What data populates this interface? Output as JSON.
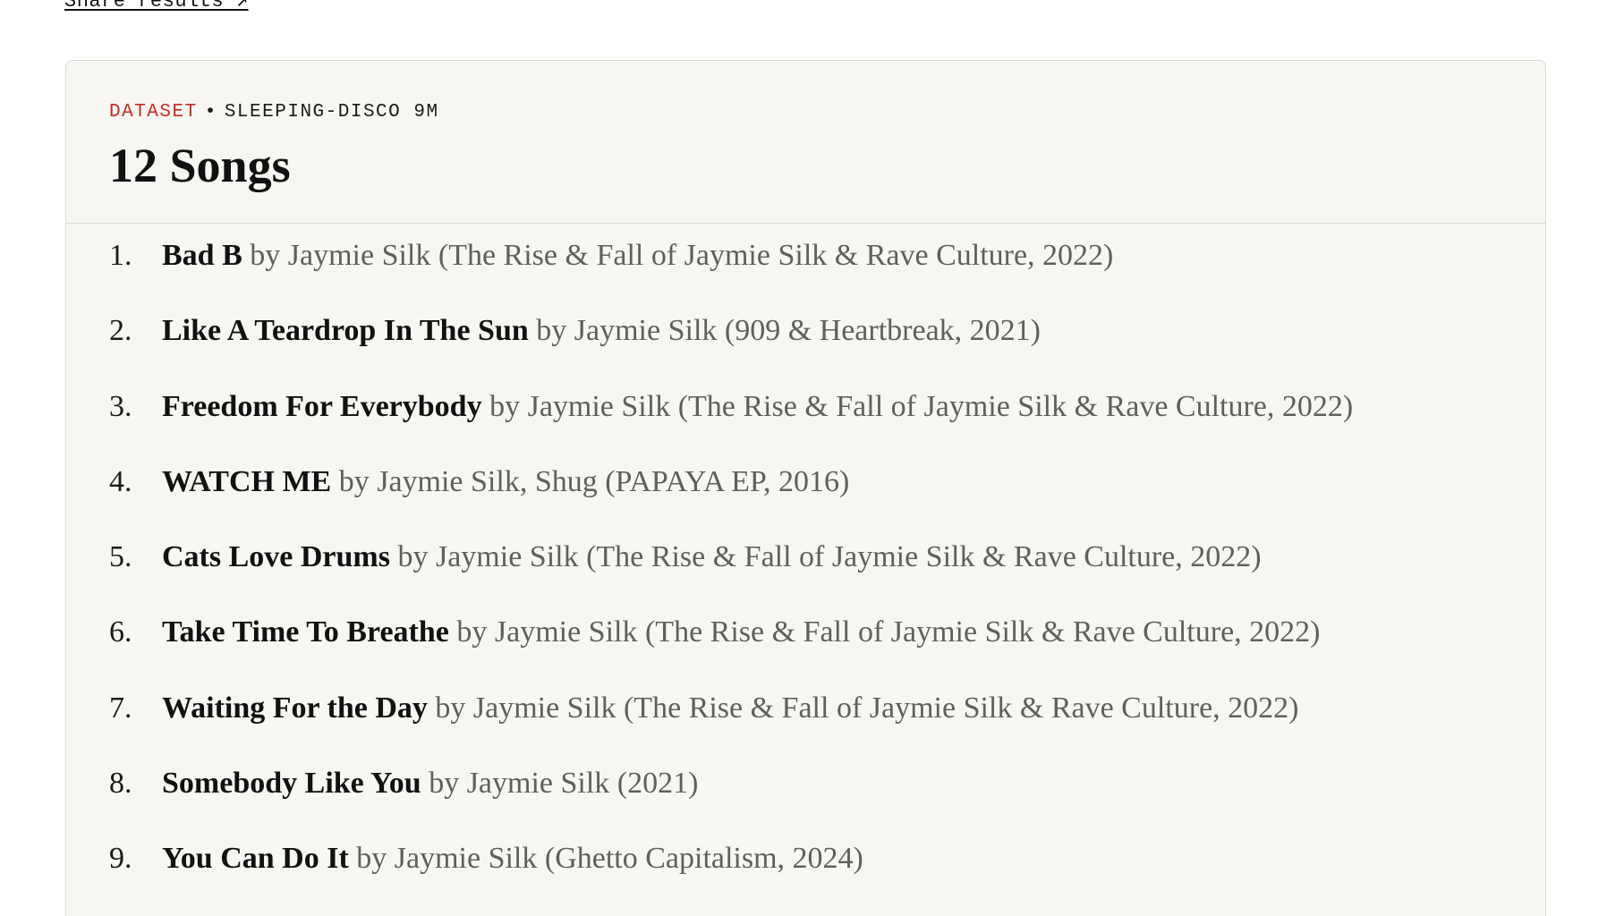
{
  "share": {
    "label": "Share results ↗"
  },
  "dataset": {
    "tag": "DATASET",
    "separator": "•",
    "name": "SLEEPING-DISCO 9M"
  },
  "title": "12 Songs",
  "songs": [
    {
      "number": "1.",
      "name": "Bad B",
      "meta": "by Jaymie Silk (The Rise & Fall of Jaymie Silk & Rave Culture, 2022)"
    },
    {
      "number": "2.",
      "name": "Like A Teardrop In The Sun",
      "meta": "by Jaymie Silk (909 & Heartbreak, 2021)"
    },
    {
      "number": "3.",
      "name": "Freedom For Everybody",
      "meta": "by Jaymie Silk (The Rise & Fall of Jaymie Silk & Rave Culture, 2022)"
    },
    {
      "number": "4.",
      "name": "WATCH ME",
      "meta": "by Jaymie Silk, Shug (PAPAYA EP, 2016)"
    },
    {
      "number": "5.",
      "name": "Cats Love Drums",
      "meta": "by Jaymie Silk (The Rise & Fall of Jaymie Silk & Rave Culture, 2022)"
    },
    {
      "number": "6.",
      "name": "Take Time To Breathe",
      "meta": "by Jaymie Silk (The Rise & Fall of Jaymie Silk & Rave Culture, 2022)"
    },
    {
      "number": "7.",
      "name": "Waiting For the Day",
      "meta": "by Jaymie Silk (The Rise & Fall of Jaymie Silk & Rave Culture, 2022)"
    },
    {
      "number": "8.",
      "name": "Somebody Like You",
      "meta": "by Jaymie Silk (2021)"
    },
    {
      "number": "9.",
      "name": "You Can Do It",
      "meta": "by Jaymie Silk (Ghetto Capitalism, 2024)"
    }
  ],
  "colors": {
    "accent": "#c62a23",
    "card_background": "#f7f6f2",
    "border": "#dcdad3",
    "meta_text": "#5f5f5f"
  }
}
